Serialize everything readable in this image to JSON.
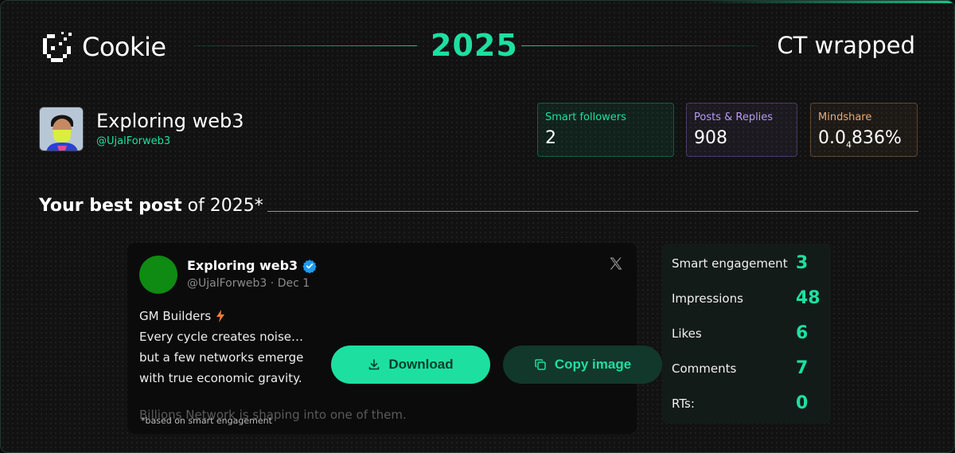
{
  "header": {
    "logo_text": "Cookie",
    "year": "2025",
    "title": "CT wrapped"
  },
  "profile": {
    "name": "Exploring web3",
    "handle": "@UjalForweb3"
  },
  "stats": [
    {
      "label": "Smart followers",
      "value": "2"
    },
    {
      "label": "Posts & Replies",
      "value": "908"
    },
    {
      "label": "Mindshare",
      "value_main": "0.0",
      "value_sub": "4",
      "value_rest": "836%"
    }
  ],
  "best_post": {
    "title_bold": "Your best post",
    "title_rest": " of 2025*",
    "footnote": "*based on smart engagement"
  },
  "tweet": {
    "author": "Exploring web3",
    "meta": "@UjalForweb3 · Dec 1",
    "lines": [
      "GM Builders",
      "Every cycle creates noise…",
      "but a few networks emerge",
      "with true economic gravity."
    ],
    "faded_line": "Billions Network is shaping into one of them.",
    "avatar_color": "#0f8a12"
  },
  "actions": {
    "download_label": "Download",
    "copy_label": "Copy image"
  },
  "metrics": [
    {
      "label": "Smart engagement",
      "value": "3"
    },
    {
      "label": "Impressions",
      "value": "48"
    },
    {
      "label": "Likes",
      "value": "6"
    },
    {
      "label": "Comments",
      "value": "7"
    },
    {
      "label": "RTs:",
      "value": "0"
    }
  ],
  "colors": {
    "accent": "#1de0a0",
    "purple": "#b79cf2",
    "orange": "#e8a978",
    "background": "#121212"
  },
  "icons": [
    "cookie-logo-icon",
    "verified-badge-icon",
    "x-logo-icon",
    "lightning-bolt-icon",
    "download-icon",
    "copy-icon"
  ]
}
